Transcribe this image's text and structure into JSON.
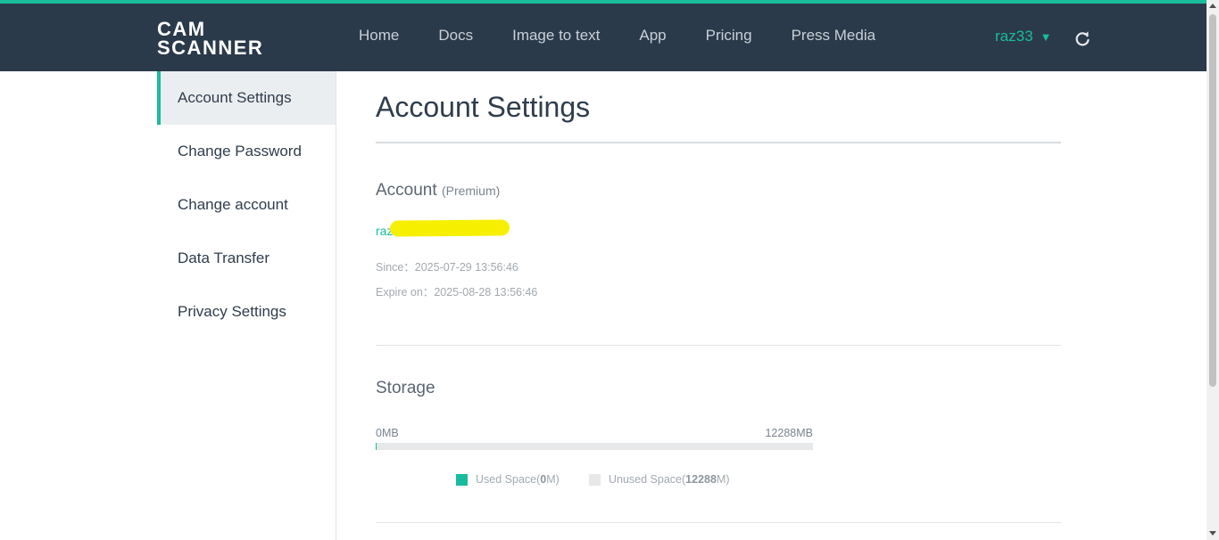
{
  "header": {
    "logo_line1": "CAM",
    "logo_line2": "SCANNER",
    "nav": [
      "Home",
      "Docs",
      "Image to text",
      "App",
      "Pricing",
      "Press Media"
    ],
    "user_name": "raz33",
    "caret_icon": "triangle-down",
    "refresh_icon": "refresh-icon"
  },
  "sidebar": {
    "items": [
      "Account Settings",
      "Change Password",
      "Change account",
      "Data Transfer",
      "Privacy Settings"
    ],
    "active_index": 0
  },
  "main": {
    "title": "Account Settings",
    "account": {
      "heading": "Account",
      "plan": "(Premium)",
      "email_visible": "raz",
      "since_label": "Since：",
      "since_value": "2025-07-29 13:56:46",
      "expire_label": "Expire on：",
      "expire_value": "2025-08-28 13:56:46"
    },
    "storage": {
      "heading": "Storage",
      "min_label": "0MB",
      "max_label": "12288MB",
      "used_fraction": 0,
      "used_prefix": "Used Space(",
      "used_value": "0",
      "used_suffix": "M)",
      "unused_prefix": "Unused Space(",
      "unused_value": "12288",
      "unused_suffix": "M)"
    }
  },
  "colors": {
    "accent": "#19bc9c",
    "header_bg": "#2b3a4a",
    "unused": "#e7e8ea"
  }
}
